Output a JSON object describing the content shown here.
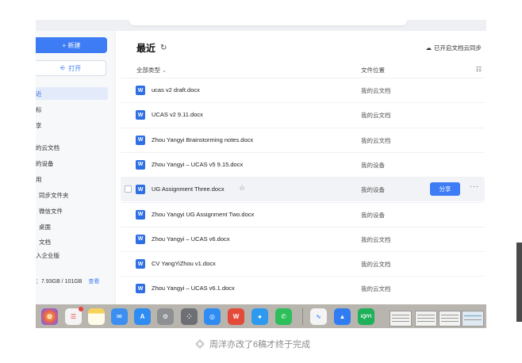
{
  "sidebar": {
    "new_label": "+ 新建",
    "open_label": "打开",
    "items": [
      {
        "label": "近",
        "active": true
      },
      {
        "label": "标"
      },
      {
        "label": "享"
      },
      {
        "label": "的云文档"
      },
      {
        "label": "的设备"
      },
      {
        "label": "用"
      },
      {
        "label": "同步文件夹"
      },
      {
        "label": "微信文件"
      },
      {
        "label": "桌面"
      },
      {
        "label": "文档"
      },
      {
        "label": "入企业版"
      }
    ],
    "storage": "：7.93GB / 101GB",
    "storage_link": "查看"
  },
  "main": {
    "title": "最近",
    "sync_label": "已开启文档云同步",
    "col_type": "全部类型",
    "col_location": "文件位置",
    "files": [
      {
        "name": "ucas v2 draft.docx",
        "location": "我的云文档"
      },
      {
        "name": "UCAS v2 9.11.docx",
        "location": "我的云文档"
      },
      {
        "name": "Zhou Yangyi Brainstorming notes.docx",
        "location": "我的云文档"
      },
      {
        "name": "Zhou Yangyi – UCAS v5 9.15.docx",
        "location": "我的设备"
      },
      {
        "name": "UG Assignment Three.docx",
        "location": "我的设备",
        "hover": true
      },
      {
        "name": "Zhou Yangyi UG Assignment Two.docx",
        "location": "我的设备"
      },
      {
        "name": "Zhou Yangyi – UCAS v6.docx",
        "location": "我的云文档"
      },
      {
        "name": "CV  YangYiZhou v1.docx",
        "location": "我的云文档"
      },
      {
        "name": "Zhou Yangyi – UCAS v6.1.docx",
        "location": "我的云文档"
      }
    ],
    "share_label": "分享",
    "file_icon_letter": "W"
  },
  "dock": {
    "apps": [
      "photos-icon",
      "reminders-icon",
      "notes-icon",
      "mail-icon",
      "app-store-icon",
      "system-settings-icon",
      "launchpad-icon",
      "safari-icon",
      "wps-icon",
      "qq-browser-icon",
      "wechat-icon",
      "freeform-icon",
      "lark-icon",
      "iqiyi-icon"
    ],
    "iqiyi_label": "iQIYI",
    "wps_label": "W"
  },
  "caption": "周洋亦改了6稿才终于完成",
  "colors": {
    "accent": "#3d7cf5",
    "word": "#2f6fe4"
  }
}
